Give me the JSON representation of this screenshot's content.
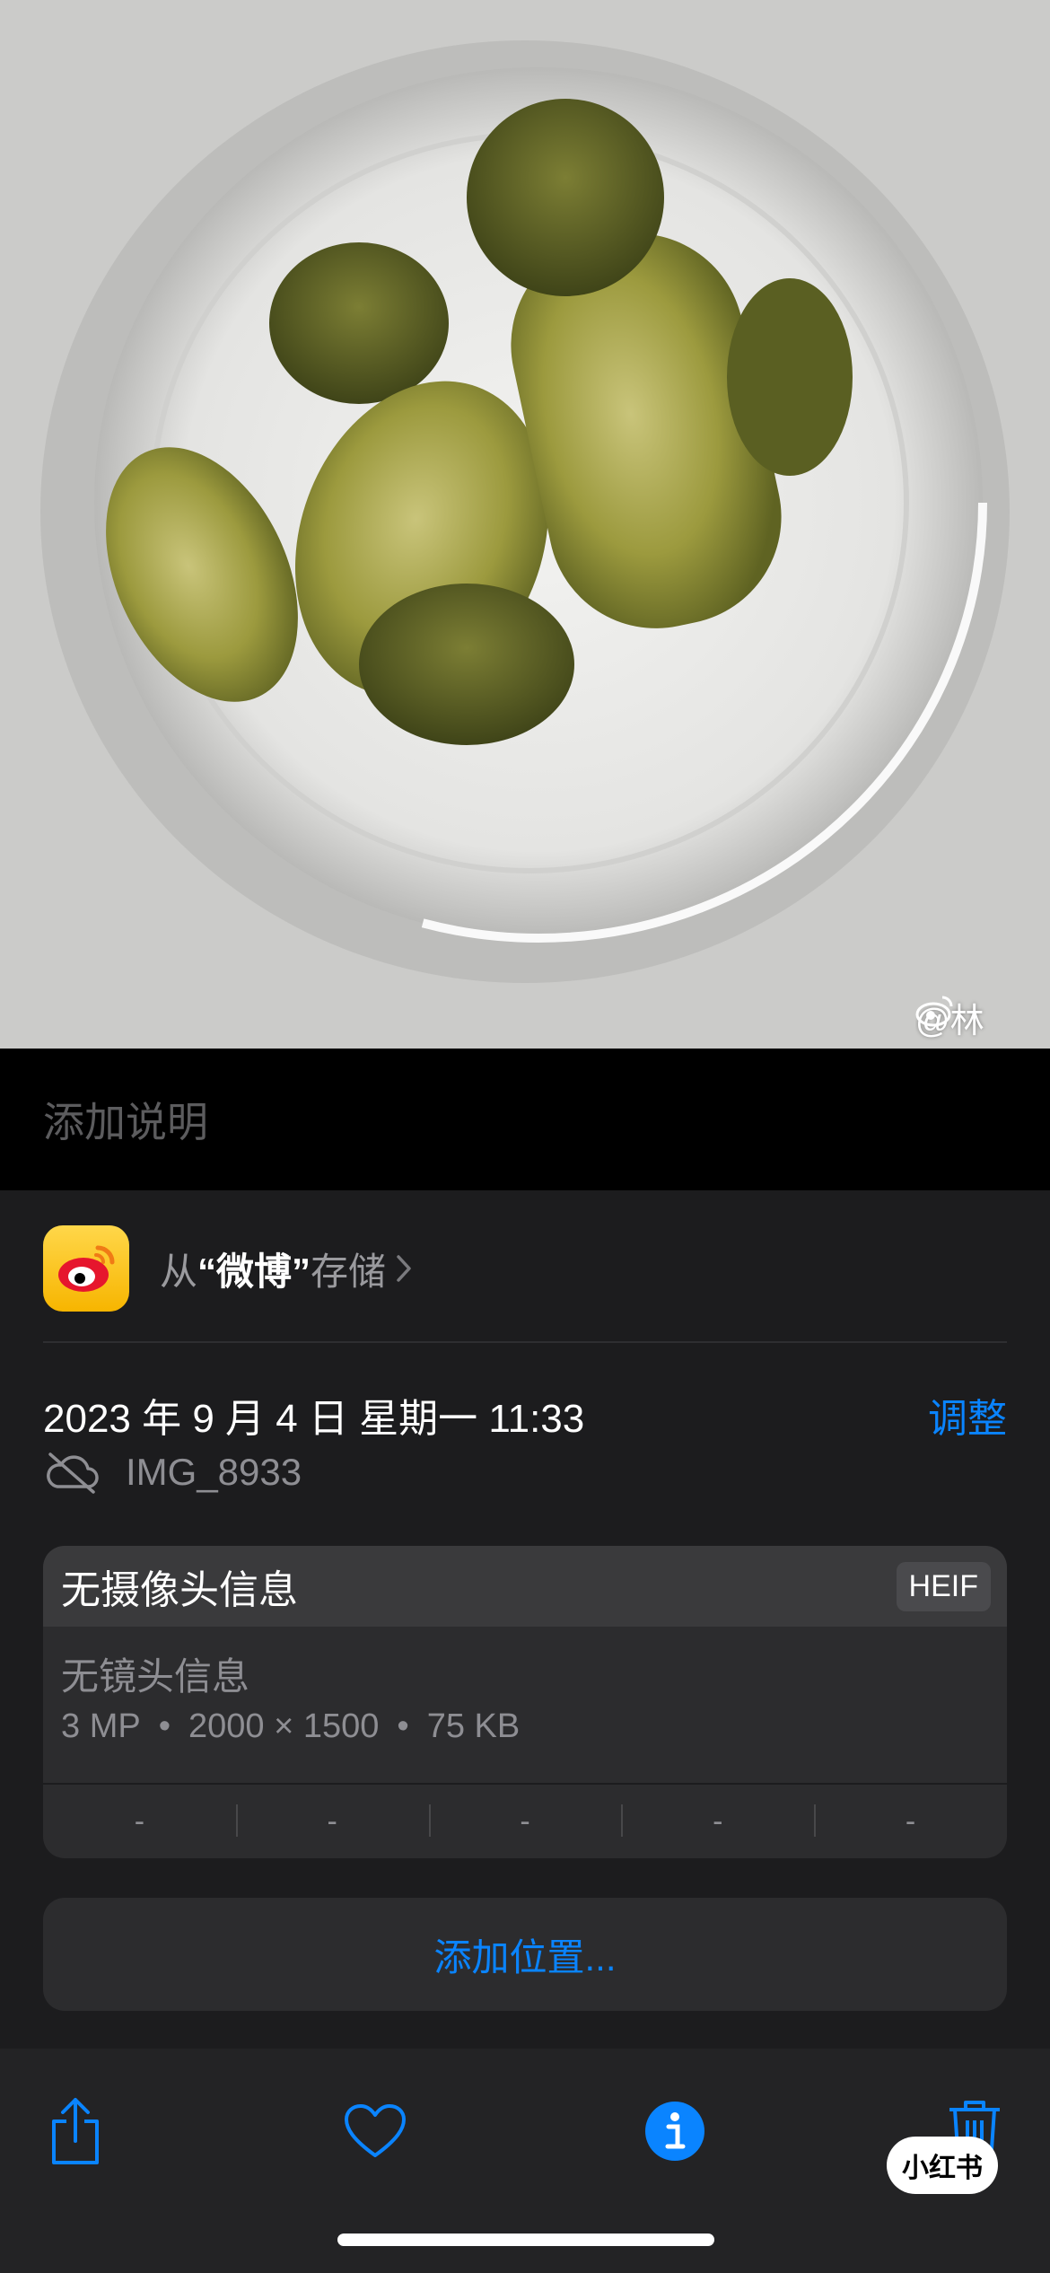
{
  "photo": {
    "watermark_text": "@林"
  },
  "caption": {
    "placeholder": "添加说明"
  },
  "source": {
    "prefix": "从",
    "app_name": "“微博”",
    "suffix": "存储",
    "icon": "weibo-icon"
  },
  "datetime": {
    "text": "2023 年 9 月 4 日  星期一 11:33",
    "adjust_label": "调整"
  },
  "file": {
    "name": "IMG_8933",
    "icon": "cloud-off-icon"
  },
  "camera": {
    "title": "无摄像头信息",
    "format": "HEIF",
    "lens": "无镜头信息",
    "megapixels": "3 MP",
    "resolution": "2000 × 1500",
    "size": "75 KB",
    "separator": "•",
    "exif": [
      "-",
      "-",
      "-",
      "-",
      "-"
    ]
  },
  "location": {
    "label": "添加位置..."
  },
  "toolbar": {
    "share_icon": "share-icon",
    "favorite_icon": "heart-icon",
    "info_icon": "info-icon",
    "delete_icon": "trash-icon"
  },
  "overlay": {
    "badge_text": "小红书"
  },
  "colors": {
    "accent": "#0a84ff",
    "panel": "#1c1c1e",
    "card": "#2c2c2e"
  }
}
